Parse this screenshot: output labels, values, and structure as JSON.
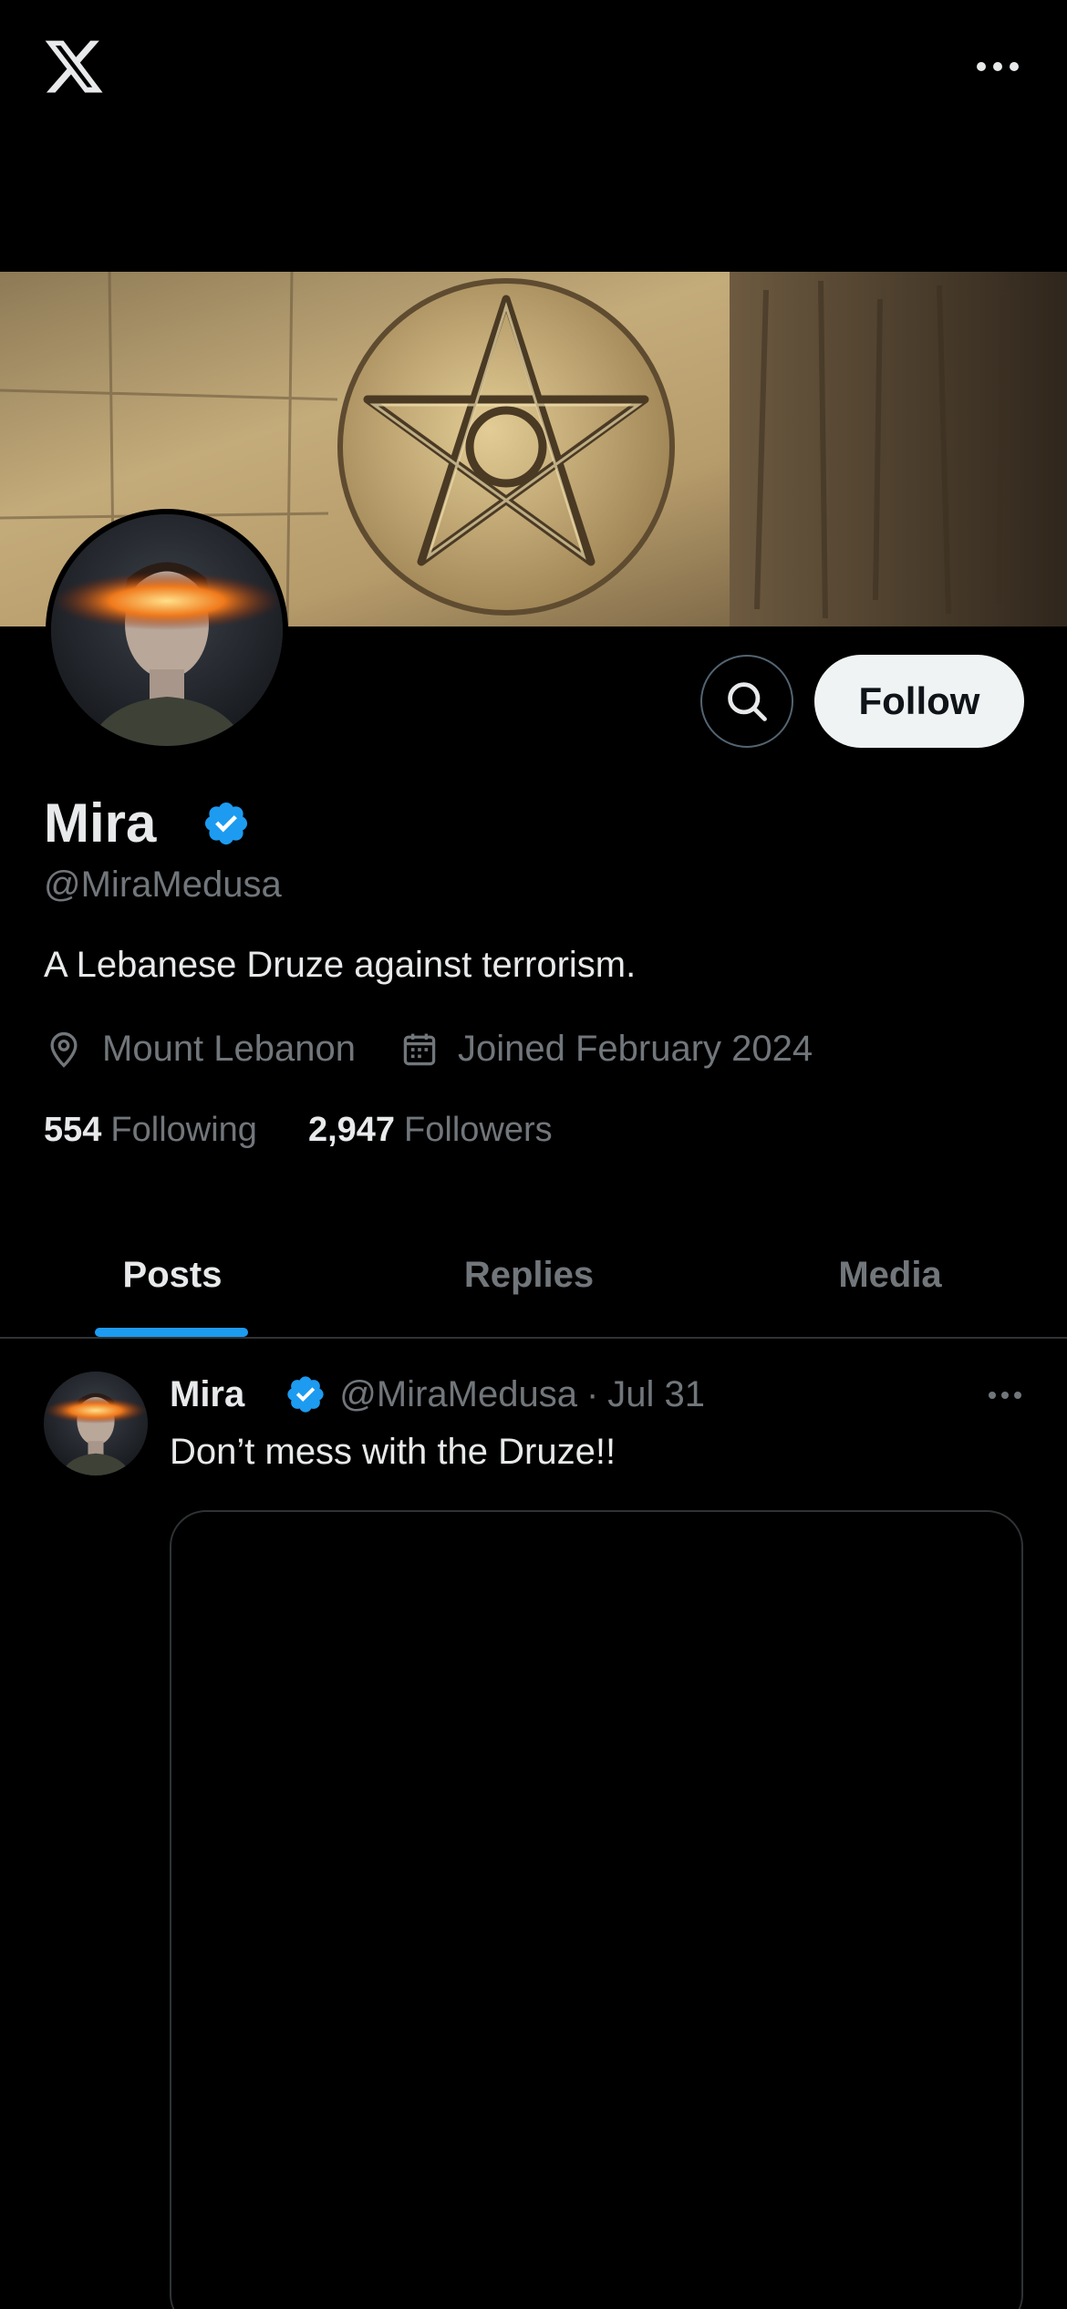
{
  "topbar": {
    "logo_icon": "x-logo-icon",
    "more_icon": "more-horizontal-icon"
  },
  "profile": {
    "display_name": "Mira",
    "verified": true,
    "handle": "@MiraMedusa",
    "bio": "A Lebanese Druze against terrorism.",
    "location": "Mount Lebanon",
    "joined": "Joined February 2024",
    "following_count": "554",
    "following_label": "Following",
    "followers_count": "2,947",
    "followers_label": "Followers"
  },
  "actions": {
    "follow_label": "Follow",
    "search_icon": "search-icon"
  },
  "tabs": [
    {
      "label": "Posts",
      "active": true
    },
    {
      "label": "Replies",
      "active": false
    },
    {
      "label": "Media",
      "active": false
    }
  ],
  "post": {
    "name": "Mira",
    "handle": "@MiraMedusa",
    "separator": "·",
    "date": "Jul 31",
    "text": "Don’t mess with the Druze!!"
  },
  "colors": {
    "background": "#000000",
    "text_primary": "#e7e9ea",
    "text_secondary": "#71767b",
    "accent": "#1d9bf0",
    "border": "#2f3336",
    "follow_button_bg": "#eff3f4"
  }
}
